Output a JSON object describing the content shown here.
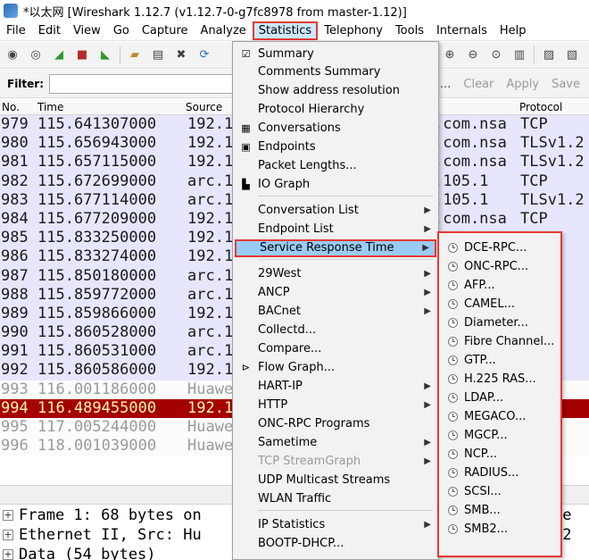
{
  "window": {
    "title": "*以太网   [Wireshark 1.12.7  (v1.12.7-0-g7fc8978 from master-1.12)]"
  },
  "menubar": [
    "File",
    "Edit",
    "View",
    "Go",
    "Capture",
    "Analyze",
    "Statistics",
    "Telephony",
    "Tools",
    "Internals",
    "Help"
  ],
  "filter": {
    "label": "Filter:",
    "expression_trunc": "sion...",
    "clear": "Clear",
    "apply": "Apply",
    "save": "Save"
  },
  "columns": {
    "no": "No.",
    "time": "Time",
    "source": "Source",
    "protocol": "Protocol"
  },
  "packets": [
    {
      "no": "979",
      "time": "115.641307000",
      "src": "192.1",
      "dst": ".com.nsa",
      "proto": "TCP",
      "style": "blue"
    },
    {
      "no": "980",
      "time": "115.656943000",
      "src": "192.1",
      "dst": ".com.nsa",
      "proto": "TLSv1.2",
      "style": "blue"
    },
    {
      "no": "981",
      "time": "115.657115000",
      "src": "192.1",
      "dst": ".com.nsa",
      "proto": "TLSv1.2",
      "style": "blue"
    },
    {
      "no": "982",
      "time": "115.672699000",
      "src": "arc.1",
      "dst": ".105.1",
      "proto": "TCP",
      "style": "blue"
    },
    {
      "no": "983",
      "time": "115.677114000",
      "src": "arc.1",
      "dst": ".105.1",
      "proto": "TLSv1.2",
      "style": "blue"
    },
    {
      "no": "984",
      "time": "115.677209000",
      "src": "192.1",
      "dst": ".com.nsa",
      "proto": "TCP",
      "style": "blue"
    },
    {
      "no": "985",
      "time": "115.833250000",
      "src": "192.1",
      "dst": "",
      "proto": "",
      "style": "blue"
    },
    {
      "no": "986",
      "time": "115.833274000",
      "src": "192.1",
      "dst": "",
      "proto": "",
      "style": "blue"
    },
    {
      "no": "987",
      "time": "115.850180000",
      "src": "arc.1",
      "dst": "",
      "proto": "",
      "style": "blue"
    },
    {
      "no": "988",
      "time": "115.859772000",
      "src": "arc.1",
      "dst": "",
      "proto": "",
      "style": "blue"
    },
    {
      "no": "989",
      "time": "115.859866000",
      "src": "192.1",
      "dst": "",
      "proto": "",
      "style": "blue"
    },
    {
      "no": "990",
      "time": "115.860528000",
      "src": "arc.1",
      "dst": "",
      "proto": "",
      "style": "blue"
    },
    {
      "no": "991",
      "time": "115.860531000",
      "src": "arc.1",
      "dst": "",
      "proto": "",
      "style": "blue"
    },
    {
      "no": "992",
      "time": "115.860586000",
      "src": "192.1",
      "dst": "",
      "proto": "",
      "style": "blue"
    },
    {
      "no": "993",
      "time": "116.001186000",
      "src": "Huawe",
      "dst": "",
      "proto": "",
      "style": "grey"
    },
    {
      "no": "994",
      "time": "116.489455000",
      "src": "192.1",
      "dst": "",
      "proto": "",
      "style": "red"
    },
    {
      "no": "995",
      "time": "117.005244000",
      "src": "Huawe",
      "dst": "",
      "proto": "",
      "style": "grey"
    },
    {
      "no": "996",
      "time": "118.001039000",
      "src": "Huawe",
      "dst": "",
      "proto": "",
      "style": "grey"
    }
  ],
  "details": [
    {
      "text": "Frame 1: 68 bytes on",
      "trunc": "re"
    },
    {
      "text": "Ethernet II, Src: Hu",
      "trunc": ":2"
    },
    {
      "text": "Data (54 bytes)",
      "trunc": ""
    }
  ],
  "stats_menu": [
    {
      "label": "Summary",
      "icon": "summary-icon"
    },
    {
      "label": "Comments Summary"
    },
    {
      "label": "Show address resolution"
    },
    {
      "label": "Protocol Hierarchy"
    },
    {
      "label": "Conversations",
      "icon": "conversations-icon"
    },
    {
      "label": "Endpoints",
      "icon": "endpoints-icon"
    },
    {
      "label": "Packet Lengths..."
    },
    {
      "label": "IO Graph",
      "icon": "io-graph-icon"
    },
    {
      "label": "Conversation List",
      "submenu": true
    },
    {
      "label": "Endpoint List",
      "submenu": true
    },
    {
      "label": "Service Response Time",
      "submenu": true,
      "highlight": true
    },
    {
      "label": "29West",
      "submenu": true
    },
    {
      "label": "ANCP",
      "submenu": true
    },
    {
      "label": "BACnet",
      "submenu": true
    },
    {
      "label": "Collectd..."
    },
    {
      "label": "Compare..."
    },
    {
      "label": "Flow Graph...",
      "icon": "flow-graph-icon"
    },
    {
      "label": "HART-IP",
      "submenu": true
    },
    {
      "label": "HTTP",
      "submenu": true
    },
    {
      "label": "ONC-RPC Programs"
    },
    {
      "label": "Sametime",
      "submenu": true
    },
    {
      "label": "TCP StreamGraph",
      "submenu": true,
      "disabled": true
    },
    {
      "label": "UDP Multicast Streams"
    },
    {
      "label": "WLAN Traffic"
    },
    {
      "label": "IP Statistics",
      "submenu": true
    },
    {
      "label": "BOOTP-DHCP..."
    }
  ],
  "srt_submenu": [
    "DCE-RPC...",
    "ONC-RPC...",
    "AFP...",
    "CAMEL...",
    "Diameter...",
    "Fibre Channel...",
    "GTP...",
    "H.225 RAS...",
    "LDAP...",
    "MEGACO...",
    "MGCP...",
    "NCP...",
    "RADIUS...",
    "SCSI...",
    "SMB...",
    "SMB2..."
  ],
  "colors": {
    "accent_red": "#e53935",
    "highlight_blue": "#99ccf4",
    "row_blue": "#e7e6ff",
    "row_red": "#a40000"
  }
}
